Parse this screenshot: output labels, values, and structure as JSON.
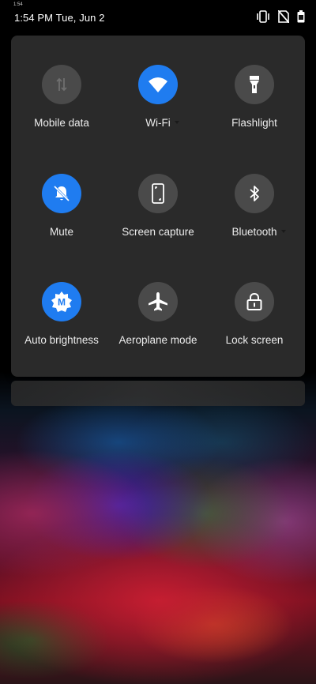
{
  "status_bar": {
    "tiny_clock": "1:54",
    "time_date": "1:54 PM Tue, Jun 2",
    "icons": [
      "vibrate-icon",
      "no-sim-icon",
      "battery-icon"
    ]
  },
  "quick_settings": {
    "colors": {
      "active": "#1f7cf0",
      "inactive": "#4a4a4a",
      "panel": "#2a2a2a"
    },
    "tiles": [
      {
        "label": "Mobile data",
        "icon": "mobile-data-icon",
        "active": false
      },
      {
        "label": "Wi-Fi",
        "icon": "wifi-icon",
        "active": true
      },
      {
        "label": "Flashlight",
        "icon": "flashlight-icon",
        "active": false
      },
      {
        "label": "Mute",
        "icon": "bell-off-icon",
        "active": true
      },
      {
        "label": "Screen capture",
        "icon": "screen-capture-icon",
        "active": false
      },
      {
        "label": "Bluetooth",
        "icon": "bluetooth-icon",
        "active": false
      },
      {
        "label": "Auto brightness",
        "icon": "auto-brightness-icon",
        "active": true
      },
      {
        "label": "Aeroplane mode",
        "icon": "airplane-icon",
        "active": false
      },
      {
        "label": "Lock screen",
        "icon": "lock-icon",
        "active": false
      }
    ],
    "auto_brightness_badge": "M"
  }
}
